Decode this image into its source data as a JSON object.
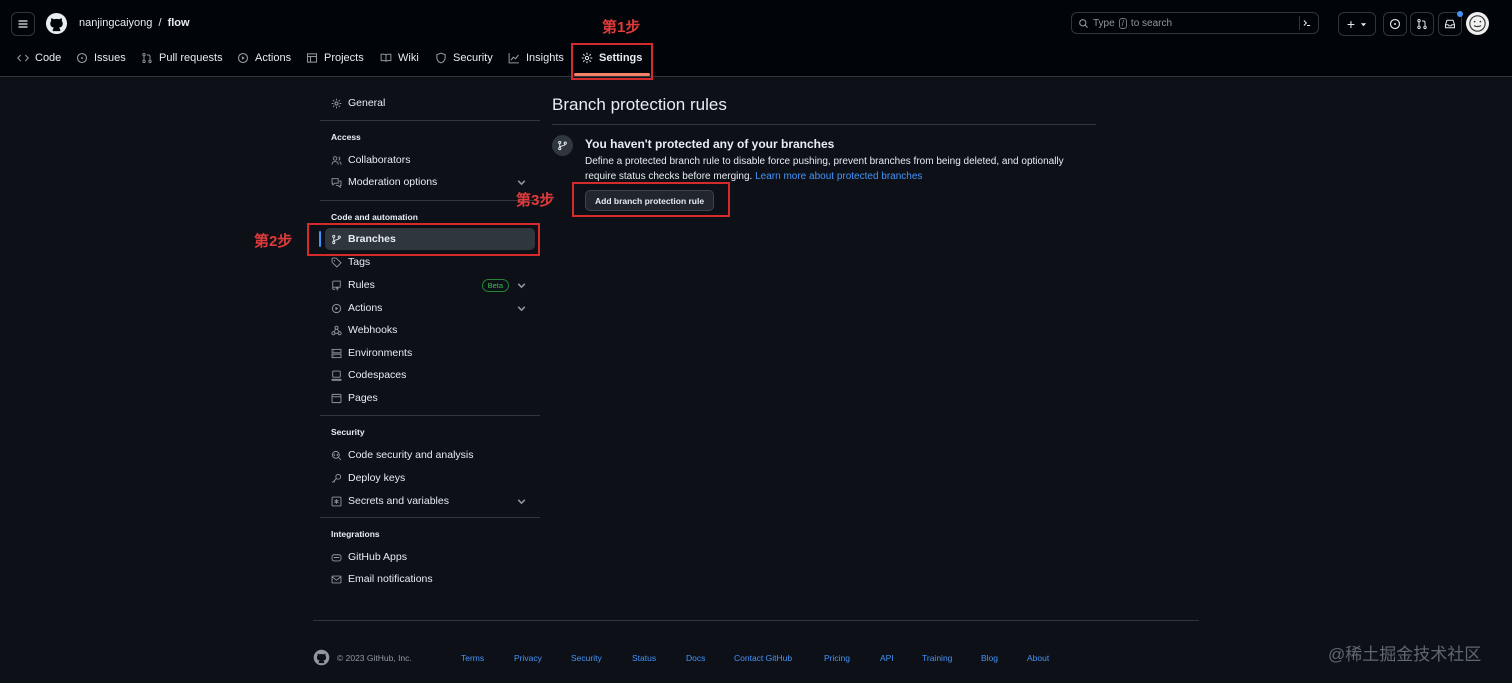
{
  "header": {
    "owner": "nanjingcaiyong",
    "separator": "/",
    "repo": "flow",
    "search_prefix": "Type",
    "search_key": "/",
    "search_suffix": "to search",
    "plus": "+"
  },
  "nav": {
    "items": [
      {
        "label": "Code"
      },
      {
        "label": "Issues"
      },
      {
        "label": "Pull requests"
      },
      {
        "label": "Actions"
      },
      {
        "label": "Projects"
      },
      {
        "label": "Wiki"
      },
      {
        "label": "Security"
      },
      {
        "label": "Insights"
      },
      {
        "label": "Settings"
      }
    ]
  },
  "annotations": {
    "step1": "第1步",
    "step2": "第2步",
    "step3": "第3步"
  },
  "sidebar": {
    "general": "General",
    "access_heading": "Access",
    "collaborators": "Collaborators",
    "moderation": "Moderation options",
    "code_heading": "Code and automation",
    "branches": "Branches",
    "tags": "Tags",
    "rules": "Rules",
    "beta": "Beta",
    "actions": "Actions",
    "webhooks": "Webhooks",
    "environments": "Environments",
    "codespaces": "Codespaces",
    "pages": "Pages",
    "security_heading": "Security",
    "code_security": "Code security and analysis",
    "deploy_keys": "Deploy keys",
    "secrets": "Secrets and variables",
    "integrations_heading": "Integrations",
    "github_apps": "GitHub Apps",
    "email_notifications": "Email notifications"
  },
  "main": {
    "title": "Branch protection rules",
    "empty_title": "You haven't protected any of your branches",
    "empty_desc_line1": "Define a protected branch rule to disable force pushing, prevent branches from being deleted, and optionally",
    "empty_desc_line2": "require status checks before merging.",
    "learn_more": "Learn more about protected branches",
    "add_button": "Add branch protection rule"
  },
  "footer": {
    "copyright": "© 2023 GitHub, Inc.",
    "links": [
      "Terms",
      "Privacy",
      "Security",
      "Status",
      "Docs",
      "Contact GitHub",
      "Pricing",
      "API",
      "Training",
      "Blog",
      "About"
    ]
  },
  "watermark": "@稀土掘金技术社区",
  "colors": {
    "background": "#0d1117",
    "header_bg": "#010409",
    "border": "#30363d",
    "link": "#4493f8",
    "annotation_red": "#d42a2a",
    "beta_green": "#3fb950"
  }
}
